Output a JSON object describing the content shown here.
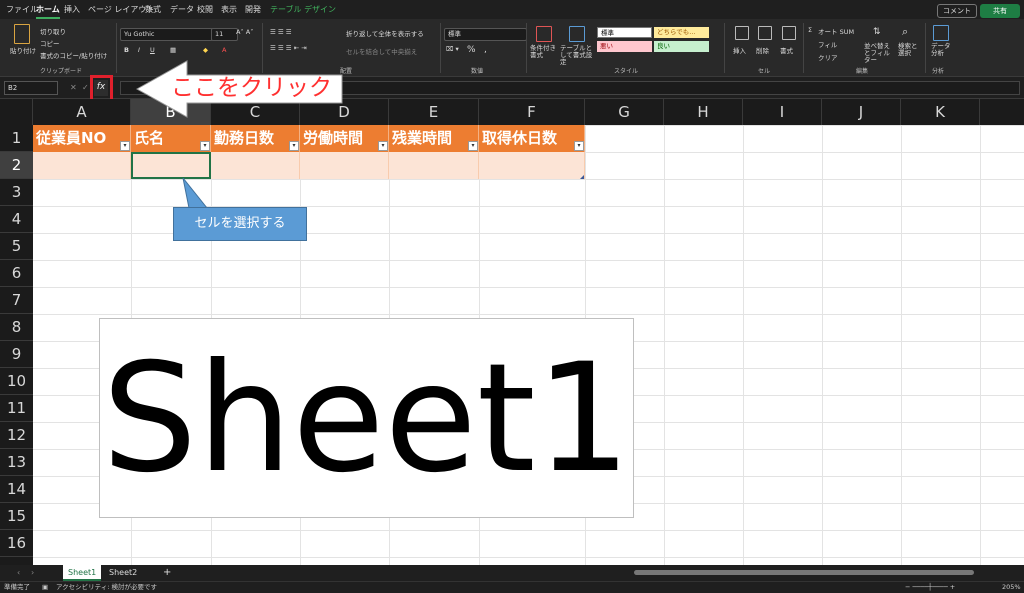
{
  "menu": {
    "tabs": [
      "ファイル",
      "ホーム",
      "挿入",
      "ページ レイアウト",
      "数式",
      "データ",
      "校閲",
      "表示",
      "開発",
      "テーブル デザイン"
    ],
    "comment_label": "コメント",
    "share_label": "共有"
  },
  "ribbon": {
    "clipboard": {
      "paste": "貼り付け",
      "cut": "切り取り",
      "copy": "コピー",
      "format_painter": "書式のコピー/貼り付け",
      "label": "クリップボード"
    },
    "font": {
      "name": "Yu Gothic",
      "size": "11",
      "bold": "B",
      "italic": "I",
      "underline": "U"
    },
    "alignment": {
      "wrap": "折り返して全体を表示する",
      "merge": "セルを結合して中央揃え",
      "label": "配置"
    },
    "number": {
      "format": "標準",
      "percent": "%",
      "comma": ",",
      "label": "数値"
    },
    "styles": {
      "conditional": "条件付き書式",
      "as_table": "テーブルとして書式設定",
      "cell_styles": [
        "標準",
        "どちらでも...",
        "悪い",
        "良い"
      ],
      "label": "スタイル"
    },
    "cells": {
      "insert": "挿入",
      "delete": "削除",
      "format": "書式",
      "label": "セル"
    },
    "editing": {
      "autosum": "オート SUM",
      "fill": "フィル",
      "clear": "クリア",
      "sort": "並べ替えとフィルター",
      "find": "検索と選択",
      "label": "編集"
    },
    "analysis": {
      "data_analysis": "データ分析",
      "label": "分析"
    }
  },
  "formula_bar": {
    "name_box": "B2",
    "fx": "fx"
  },
  "columns": [
    "A",
    "B",
    "C",
    "D",
    "E",
    "F",
    "G",
    "H",
    "I",
    "J",
    "K"
  ],
  "rows": [
    "1",
    "2",
    "3",
    "4",
    "5",
    "6",
    "7",
    "8",
    "9",
    "10",
    "11",
    "12",
    "13",
    "14",
    "15",
    "16"
  ],
  "table": {
    "headers": [
      "従業員NO",
      "氏名",
      "勤務日数",
      "労働時間",
      "残業時間",
      "取得休日数"
    ],
    "dropdown_icon": "▾"
  },
  "overlay_image_text": "Sheet1",
  "callouts": {
    "click_here": "ここをクリック",
    "select_cell": "セルを選択する"
  },
  "sheet_tabs": [
    "Sheet1",
    "Sheet2"
  ],
  "add_sheet": "+",
  "status": {
    "ready": "準備完了",
    "accessibility": "アクセシビリティ: 検討が必要です",
    "zoom": "205%"
  },
  "colors": {
    "accent": "#217346",
    "table_header": "#ed7d31",
    "table_row": "#fce4d6",
    "highlight_red": "#e0202c",
    "callout_blue": "#5b9bd5"
  }
}
